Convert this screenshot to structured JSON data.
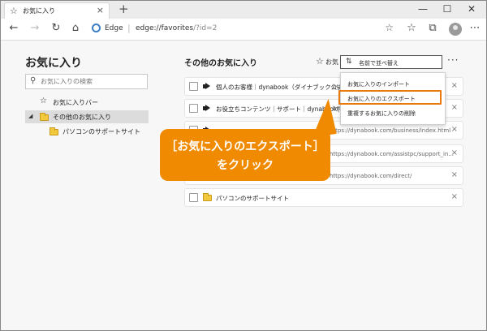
{
  "tab": {
    "title": "お気に入り",
    "close": "×",
    "new_tab": "+"
  },
  "window": {
    "minimize": "—",
    "maximize": "☐",
    "close": "✕"
  },
  "address_bar": {
    "site_label": "Edge",
    "url_main": "edge://favorites",
    "url_query": "/?id=2"
  },
  "left_pane": {
    "title": "お気に入り",
    "search_placeholder": "お気に入りの検索",
    "tree": [
      {
        "label": "お気に入りバー"
      },
      {
        "label": "その他のお気に入り"
      },
      {
        "label": "パソコンのサポートサイト"
      }
    ]
  },
  "right_pane": {
    "section_title": "その他のお気に入り",
    "add_label": "お気",
    "more_label": "···",
    "rows": [
      {
        "name": "個人のお客様｜dynabook（ダイナブック公式）",
        "url": "htt"
      },
      {
        "name": "お役立ちコンテンツ｜サポート｜dynabook(ダイ...",
        "url": "htt"
      },
      {
        "name": "",
        "url": "https://dynabook.com/business/index.html"
      },
      {
        "name": "",
        "url": "https://dynabook.com/assistpc/support_in..."
      },
      {
        "name": "",
        "url": "https://dynabook.com/direct/"
      },
      {
        "name": "パソコンのサポートサイト",
        "url": ""
      }
    ]
  },
  "menu": {
    "sort_label": "名前で並べ替え",
    "items": [
      {
        "label": "お気に入りのインポート"
      },
      {
        "label": "お気に入りのエクスポート"
      },
      {
        "label": "重複するお気に入りの削除"
      }
    ]
  },
  "callout": {
    "line1": "［お気に入りのエクスポート］",
    "line2": "をクリック"
  },
  "colors": {
    "accent": "#f08a00",
    "highlight_border": "#e8790a"
  }
}
